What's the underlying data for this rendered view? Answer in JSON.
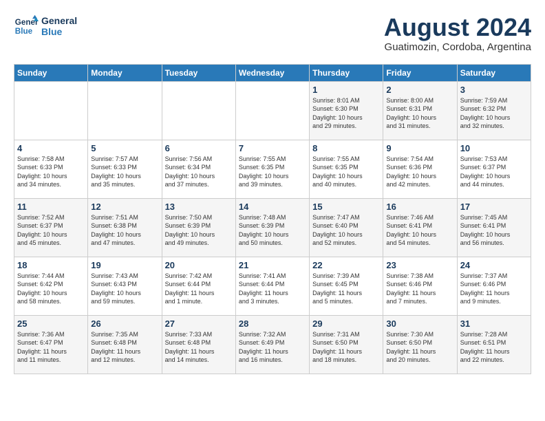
{
  "logo": {
    "line1": "General",
    "line2": "Blue"
  },
  "title": {
    "month_year": "August 2024",
    "location": "Guatimozin, Cordoba, Argentina"
  },
  "days_of_week": [
    "Sunday",
    "Monday",
    "Tuesday",
    "Wednesday",
    "Thursday",
    "Friday",
    "Saturday"
  ],
  "weeks": [
    [
      {
        "day": "",
        "content": ""
      },
      {
        "day": "",
        "content": ""
      },
      {
        "day": "",
        "content": ""
      },
      {
        "day": "",
        "content": ""
      },
      {
        "day": "1",
        "content": "Sunrise: 8:01 AM\nSunset: 6:30 PM\nDaylight: 10 hours\nand 29 minutes."
      },
      {
        "day": "2",
        "content": "Sunrise: 8:00 AM\nSunset: 6:31 PM\nDaylight: 10 hours\nand 31 minutes."
      },
      {
        "day": "3",
        "content": "Sunrise: 7:59 AM\nSunset: 6:32 PM\nDaylight: 10 hours\nand 32 minutes."
      }
    ],
    [
      {
        "day": "4",
        "content": "Sunrise: 7:58 AM\nSunset: 6:33 PM\nDaylight: 10 hours\nand 34 minutes."
      },
      {
        "day": "5",
        "content": "Sunrise: 7:57 AM\nSunset: 6:33 PM\nDaylight: 10 hours\nand 35 minutes."
      },
      {
        "day": "6",
        "content": "Sunrise: 7:56 AM\nSunset: 6:34 PM\nDaylight: 10 hours\nand 37 minutes."
      },
      {
        "day": "7",
        "content": "Sunrise: 7:55 AM\nSunset: 6:35 PM\nDaylight: 10 hours\nand 39 minutes."
      },
      {
        "day": "8",
        "content": "Sunrise: 7:55 AM\nSunset: 6:35 PM\nDaylight: 10 hours\nand 40 minutes."
      },
      {
        "day": "9",
        "content": "Sunrise: 7:54 AM\nSunset: 6:36 PM\nDaylight: 10 hours\nand 42 minutes."
      },
      {
        "day": "10",
        "content": "Sunrise: 7:53 AM\nSunset: 6:37 PM\nDaylight: 10 hours\nand 44 minutes."
      }
    ],
    [
      {
        "day": "11",
        "content": "Sunrise: 7:52 AM\nSunset: 6:37 PM\nDaylight: 10 hours\nand 45 minutes."
      },
      {
        "day": "12",
        "content": "Sunrise: 7:51 AM\nSunset: 6:38 PM\nDaylight: 10 hours\nand 47 minutes."
      },
      {
        "day": "13",
        "content": "Sunrise: 7:50 AM\nSunset: 6:39 PM\nDaylight: 10 hours\nand 49 minutes."
      },
      {
        "day": "14",
        "content": "Sunrise: 7:48 AM\nSunset: 6:39 PM\nDaylight: 10 hours\nand 50 minutes."
      },
      {
        "day": "15",
        "content": "Sunrise: 7:47 AM\nSunset: 6:40 PM\nDaylight: 10 hours\nand 52 minutes."
      },
      {
        "day": "16",
        "content": "Sunrise: 7:46 AM\nSunset: 6:41 PM\nDaylight: 10 hours\nand 54 minutes."
      },
      {
        "day": "17",
        "content": "Sunrise: 7:45 AM\nSunset: 6:41 PM\nDaylight: 10 hours\nand 56 minutes."
      }
    ],
    [
      {
        "day": "18",
        "content": "Sunrise: 7:44 AM\nSunset: 6:42 PM\nDaylight: 10 hours\nand 58 minutes."
      },
      {
        "day": "19",
        "content": "Sunrise: 7:43 AM\nSunset: 6:43 PM\nDaylight: 10 hours\nand 59 minutes."
      },
      {
        "day": "20",
        "content": "Sunrise: 7:42 AM\nSunset: 6:44 PM\nDaylight: 11 hours\nand 1 minute."
      },
      {
        "day": "21",
        "content": "Sunrise: 7:41 AM\nSunset: 6:44 PM\nDaylight: 11 hours\nand 3 minutes."
      },
      {
        "day": "22",
        "content": "Sunrise: 7:39 AM\nSunset: 6:45 PM\nDaylight: 11 hours\nand 5 minutes."
      },
      {
        "day": "23",
        "content": "Sunrise: 7:38 AM\nSunset: 6:46 PM\nDaylight: 11 hours\nand 7 minutes."
      },
      {
        "day": "24",
        "content": "Sunrise: 7:37 AM\nSunset: 6:46 PM\nDaylight: 11 hours\nand 9 minutes."
      }
    ],
    [
      {
        "day": "25",
        "content": "Sunrise: 7:36 AM\nSunset: 6:47 PM\nDaylight: 11 hours\nand 11 minutes."
      },
      {
        "day": "26",
        "content": "Sunrise: 7:35 AM\nSunset: 6:48 PM\nDaylight: 11 hours\nand 12 minutes."
      },
      {
        "day": "27",
        "content": "Sunrise: 7:33 AM\nSunset: 6:48 PM\nDaylight: 11 hours\nand 14 minutes."
      },
      {
        "day": "28",
        "content": "Sunrise: 7:32 AM\nSunset: 6:49 PM\nDaylight: 11 hours\nand 16 minutes."
      },
      {
        "day": "29",
        "content": "Sunrise: 7:31 AM\nSunset: 6:50 PM\nDaylight: 11 hours\nand 18 minutes."
      },
      {
        "day": "30",
        "content": "Sunrise: 7:30 AM\nSunset: 6:50 PM\nDaylight: 11 hours\nand 20 minutes."
      },
      {
        "day": "31",
        "content": "Sunrise: 7:28 AM\nSunset: 6:51 PM\nDaylight: 11 hours\nand 22 minutes."
      }
    ]
  ]
}
